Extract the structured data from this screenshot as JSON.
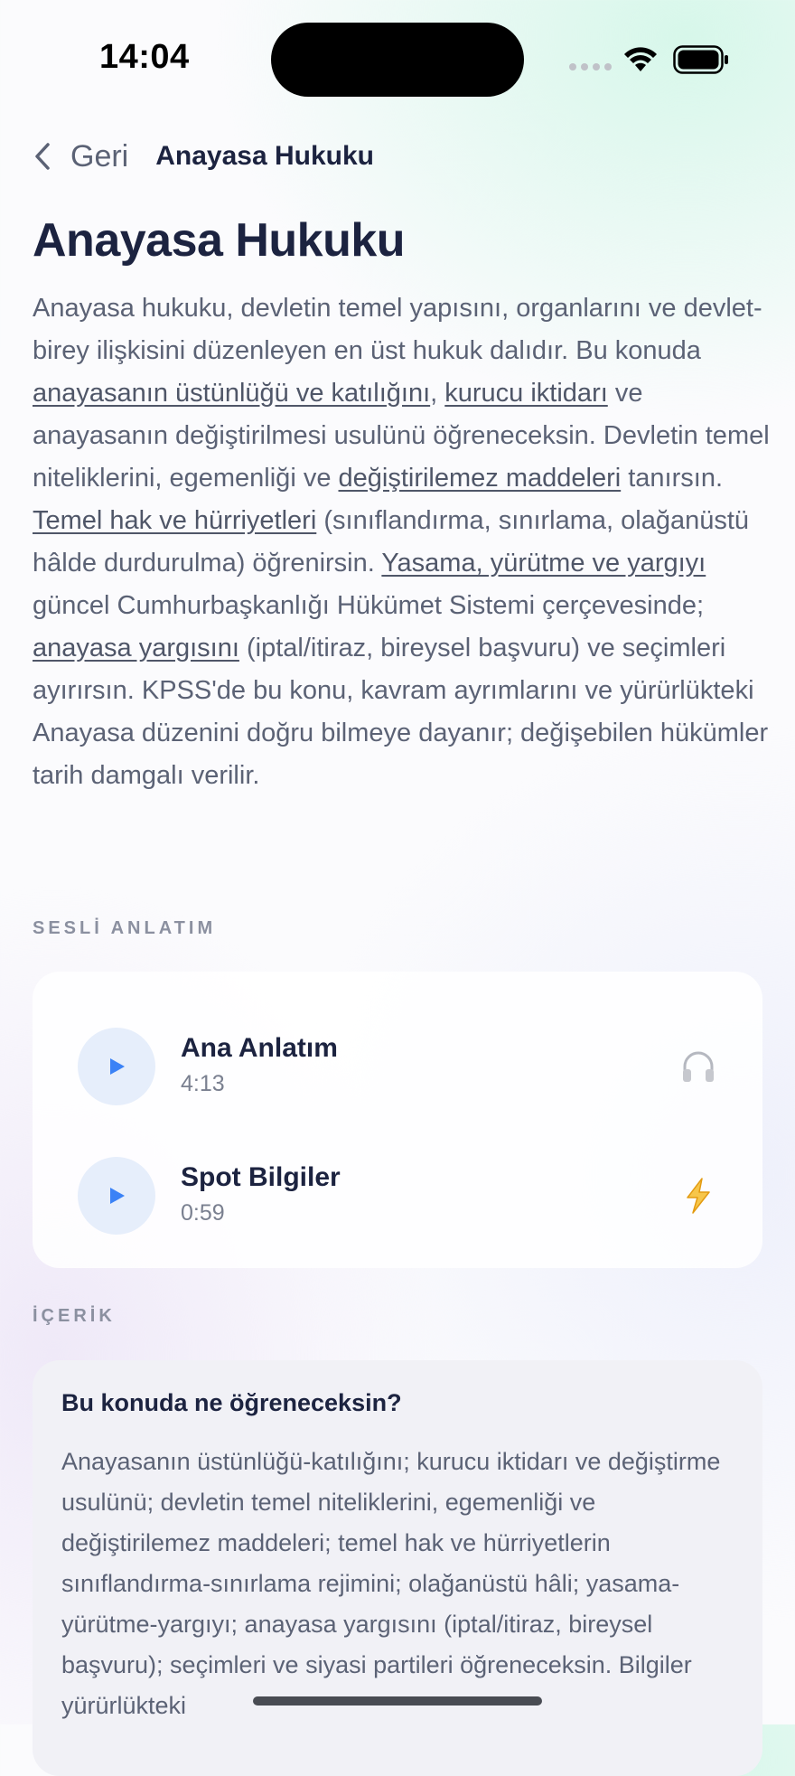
{
  "status_bar": {
    "time": "14:04"
  },
  "nav": {
    "back_label": "Geri",
    "title": "Anayasa Hukuku"
  },
  "page": {
    "title": "Anayasa Hukuku",
    "intro": [
      {
        "text": "Anayasa hukuku, devletin temel yapısını, organlarını ve devlet-birey ilişkisini düzenleyen en üst hukuk dalıdır. Bu konuda "
      },
      {
        "text": "anayasanın üstünlüğü ve katılığını",
        "link": true
      },
      {
        "text": ", "
      },
      {
        "text": "kurucu iktidarı",
        "link": true
      },
      {
        "text": " ve anayasanın değiştirilmesi usulünü öğreneceksin. Devletin temel niteliklerini, egemenliği ve "
      },
      {
        "text": "değiştirilemez maddeleri",
        "link": true
      },
      {
        "text": " tanırsın. "
      },
      {
        "text": "Temel hak ve hürriyetleri",
        "link": true
      },
      {
        "text": " (sınıflandırma, sınırlama, olağanüstü hâlde durdurulma) öğrenirsin. "
      },
      {
        "text": "Yasama, yürütme ve yargıyı",
        "link": true
      },
      {
        "text": " güncel Cumhurbaşkanlığı Hükümet Sistemi çerçevesinde; "
      },
      {
        "text": "anayasa yargısını",
        "link": true
      },
      {
        "text": " (iptal/itiraz, bireysel başvuru) ve seçimleri ayırırsın. KPSS'de bu konu, kavram ayrımlarını ve yürürlükteki Anayasa düzenini doğru bilmeye dayanır; değişebilen hükümler tarih damgalı verilir."
      }
    ]
  },
  "audio_section": {
    "label": "SESLİ ANLATIM",
    "items": [
      {
        "title": "Ana Anlatım",
        "duration": "4:13",
        "icon": "headphones-icon"
      },
      {
        "title": "Spot Bilgiler",
        "duration": "0:59",
        "icon": "lightning-icon"
      }
    ]
  },
  "content_section": {
    "label": "İÇERİK",
    "card": {
      "heading": "Bu konuda ne öğreneceksin?",
      "text": "Anayasanın üstünlüğü-katılığını; kurucu iktidarı ve değiştirme usulünü; devletin temel niteliklerini, egemenliği ve değiştirilemez maddeleri; temel hak ve hürriyetlerin sınıflandırma-sınırlama rejimini; olağanüstü hâli; yasama-yürütme-yargıyı; anayasa yargısını (iptal/itiraz, bireysel başvuru); seçimleri ve siyasi partileri öğreneceksin. Bilgiler yürürlükteki"
    }
  },
  "colors": {
    "accent_blue": "#3b82f6",
    "play_bg": "#e6eefb",
    "lightning": "#f2b01e",
    "title": "#1c2340",
    "body_text": "#5b6275"
  }
}
